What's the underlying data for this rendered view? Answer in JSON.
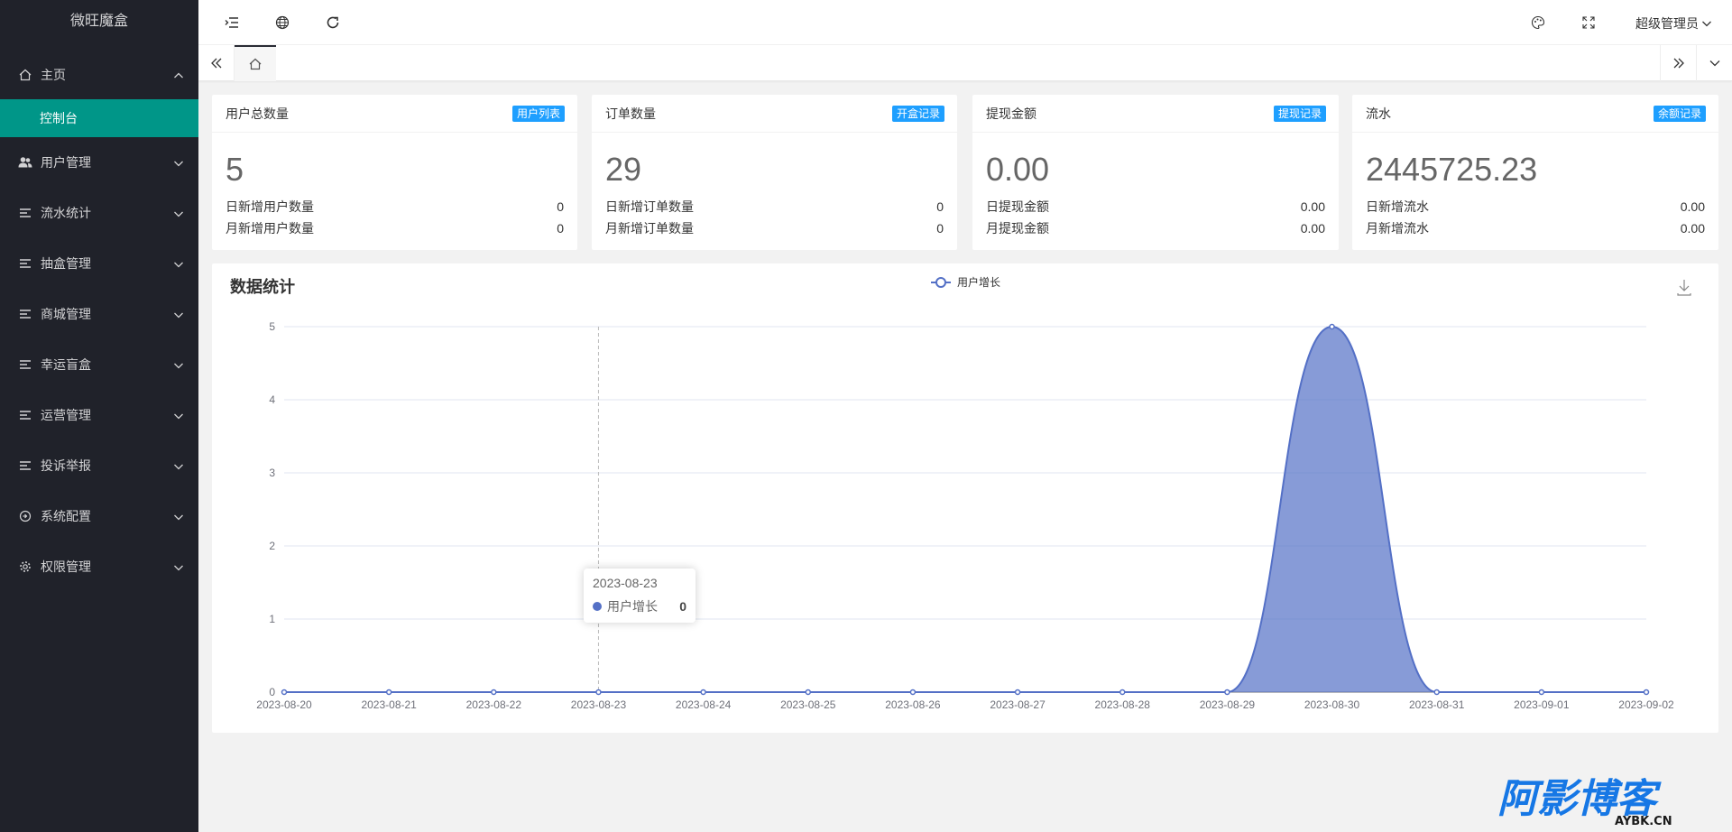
{
  "app": {
    "title": "微旺魔盒"
  },
  "sidebar": {
    "items": [
      {
        "label": "主页",
        "icon": "home-icon",
        "expanded": true,
        "children": [
          {
            "label": "控制台",
            "active": true
          }
        ]
      },
      {
        "label": "用户管理",
        "icon": "users-icon"
      },
      {
        "label": "流水统计",
        "icon": "list-icon"
      },
      {
        "label": "抽盒管理",
        "icon": "list-icon"
      },
      {
        "label": "商城管理",
        "icon": "list-icon"
      },
      {
        "label": "幸运盲盒",
        "icon": "list-icon"
      },
      {
        "label": "运营管理",
        "icon": "list-icon"
      },
      {
        "label": "投诉举报",
        "icon": "list-icon"
      },
      {
        "label": "系统配置",
        "icon": "settings-circle-icon"
      },
      {
        "label": "权限管理",
        "icon": "gear-icon"
      }
    ]
  },
  "header": {
    "icons": [
      "menu-fold-icon",
      "globe-icon",
      "refresh-icon",
      "theme-icon",
      "fullscreen-icon"
    ],
    "user": "超级管理员"
  },
  "cards": [
    {
      "title": "用户总数量",
      "badge": "用户列表",
      "value": "5",
      "rows": [
        {
          "label": "日新增用户数量",
          "value": "0"
        },
        {
          "label": "月新增用户数量",
          "value": "0"
        }
      ]
    },
    {
      "title": "订单数量",
      "badge": "开盒记录",
      "value": "29",
      "rows": [
        {
          "label": "日新增订单数量",
          "value": "0"
        },
        {
          "label": "月新增订单数量",
          "value": "0"
        }
      ]
    },
    {
      "title": "提现金额",
      "badge": "提现记录",
      "value": "0.00",
      "rows": [
        {
          "label": "日提现金额",
          "value": "0.00"
        },
        {
          "label": "月提现金额",
          "value": "0.00"
        }
      ]
    },
    {
      "title": "流水",
      "badge": "余额记录",
      "value": "2445725.23",
      "rows": [
        {
          "label": "日新增流水",
          "value": "0.00"
        },
        {
          "label": "月新增流水",
          "value": "0.00"
        }
      ]
    }
  ],
  "panel": {
    "title": "数据统计"
  },
  "chart_data": {
    "type": "area",
    "x": [
      "2023-08-20",
      "2023-08-21",
      "2023-08-22",
      "2023-08-23",
      "2023-08-24",
      "2023-08-25",
      "2023-08-26",
      "2023-08-27",
      "2023-08-28",
      "2023-08-29",
      "2023-08-30",
      "2023-08-31",
      "2023-09-01",
      "2023-09-02"
    ],
    "series": [
      {
        "name": "用户增长",
        "values": [
          0,
          0,
          0,
          0,
          0,
          0,
          0,
          0,
          0,
          0,
          5,
          0,
          0,
          0
        ]
      }
    ],
    "ylim": [
      0,
      5
    ],
    "yticks": [
      0,
      1,
      2,
      3,
      4,
      5
    ],
    "grid": true,
    "legend": "top-center",
    "smooth": true,
    "color": "#5470c6",
    "tooltip": {
      "x": "2023-08-23",
      "series": "用户增长",
      "value": "0"
    }
  },
  "watermark": {
    "text": "阿影博客",
    "sub": "AYBK.CN"
  },
  "colors": {
    "sidebar_bg": "#20222a",
    "active": "#009688",
    "badge": "#1e9fff"
  }
}
